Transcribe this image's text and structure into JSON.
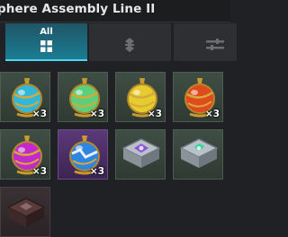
{
  "window": {
    "title": "phere Assembly Line II"
  },
  "tabs": [
    {
      "label": "All",
      "icon": "grid-icon",
      "active": true
    },
    {
      "label": "",
      "icon": "diamond-stack-icon",
      "active": false
    },
    {
      "label": "",
      "icon": "equalizer-icon",
      "active": false
    }
  ],
  "items": [
    {
      "name": "blue-sphere",
      "quantity": "×3",
      "color": "#33b7d9"
    },
    {
      "name": "green-sphere",
      "quantity": "×3",
      "color": "#5ccf7a"
    },
    {
      "name": "yellow-sphere",
      "quantity": "×3",
      "color": "#e6cc2e"
    },
    {
      "name": "red-sphere",
      "quantity": "×3",
      "color": "#e04a1f"
    },
    {
      "name": "magenta-sphere",
      "quantity": "×3",
      "color": "#c22bc9"
    },
    {
      "name": "shattered-blue-sphere",
      "quantity": "×3",
      "color": "#2f86e0"
    },
    {
      "name": "planar-module-purple",
      "quantity": "",
      "color": "#a8b0b8"
    },
    {
      "name": "planar-module-green",
      "quantity": "",
      "color": "#a8b0b8"
    },
    {
      "name": "dark-container",
      "quantity": "",
      "color": "#5a3a3a"
    }
  ]
}
